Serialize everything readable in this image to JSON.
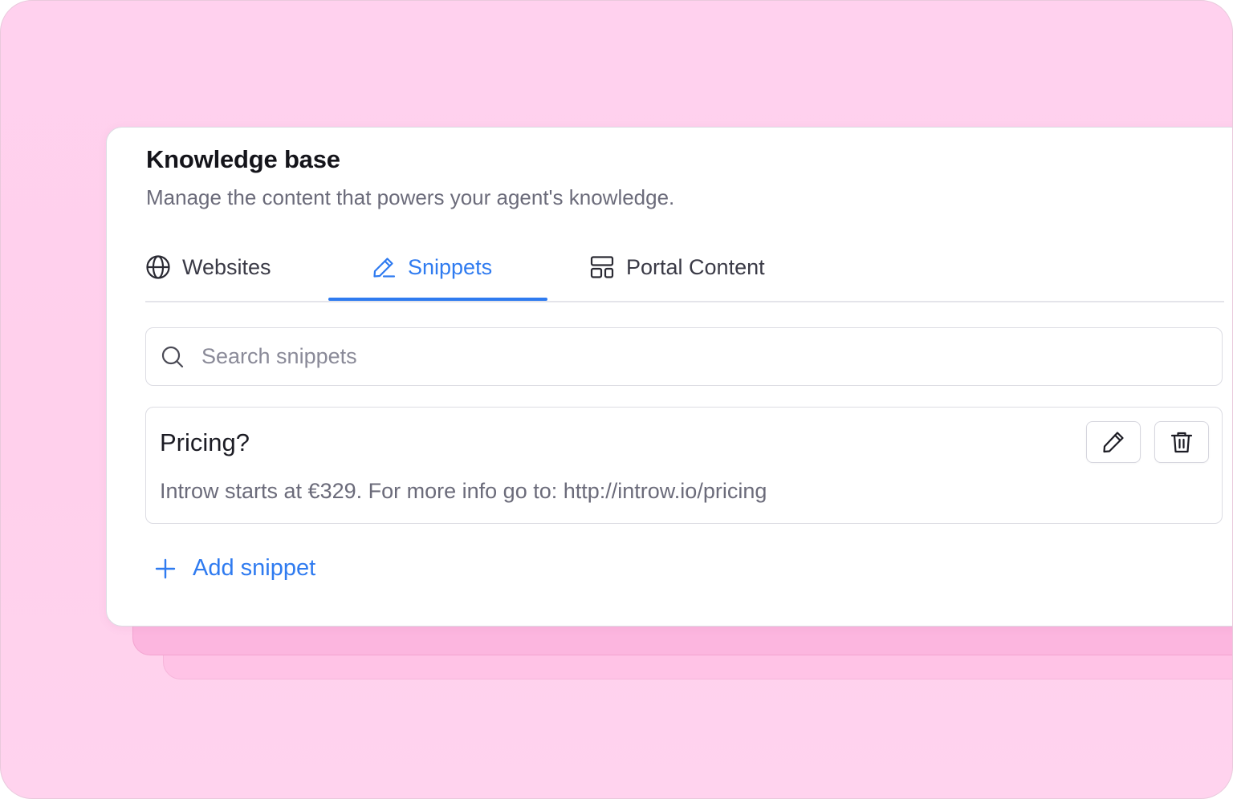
{
  "header": {
    "title": "Knowledge base",
    "subtitle": "Manage the content that powers your agent's knowledge."
  },
  "tabs": [
    {
      "label": "Websites",
      "icon": "globe-icon",
      "active": false
    },
    {
      "label": "Snippets",
      "icon": "pencil-icon",
      "active": true
    },
    {
      "label": "Portal Content",
      "icon": "layout-icon",
      "active": false
    }
  ],
  "search": {
    "placeholder": "Search snippets",
    "value": "",
    "icon": "search-icon"
  },
  "snippets": [
    {
      "title": "Pricing?",
      "body": "Introw starts at €329. For more info go to: http://introw.io/pricing",
      "actions": [
        "edit-icon",
        "trash-icon"
      ]
    }
  ],
  "add_snippet": {
    "label": "Add snippet",
    "icon": "plus-icon"
  },
  "colors": {
    "accent": "#2f7bf0",
    "background": "#ffd1ee",
    "text_primary": "#14141a",
    "text_secondary": "#6b6b7a"
  }
}
